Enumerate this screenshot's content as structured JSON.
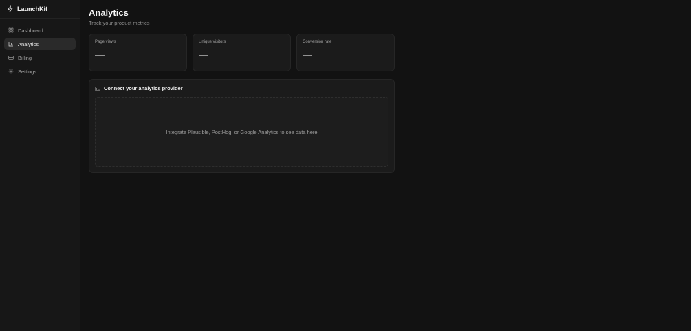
{
  "app": {
    "name": "LaunchKit",
    "logo_icon": "lightning-bolt-icon"
  },
  "sidebar": {
    "items": [
      {
        "label": "Dashboard",
        "icon": "grid-icon",
        "active": false
      },
      {
        "label": "Analytics",
        "icon": "bar-chart-icon",
        "active": true
      },
      {
        "label": "Billing",
        "icon": "credit-card-icon",
        "active": false
      },
      {
        "label": "Settings",
        "icon": "gear-icon",
        "active": false
      }
    ]
  },
  "header": {
    "title": "Analytics",
    "subtitle": "Track your product metrics"
  },
  "stats": [
    {
      "label": "Page views",
      "value": "—"
    },
    {
      "label": "Unique visitors",
      "value": "—"
    },
    {
      "label": "Conversion rate",
      "value": "—"
    }
  ],
  "provider": {
    "title": "Connect your analytics provider",
    "icon": "bar-chart-icon",
    "message": "Integrate Plausible, PostHog, or Google Analytics to see data here"
  },
  "colors": {
    "background": "#121212",
    "sidebar": "#171717",
    "card": "#1b1b1b",
    "active_item": "#2a2a2a"
  }
}
